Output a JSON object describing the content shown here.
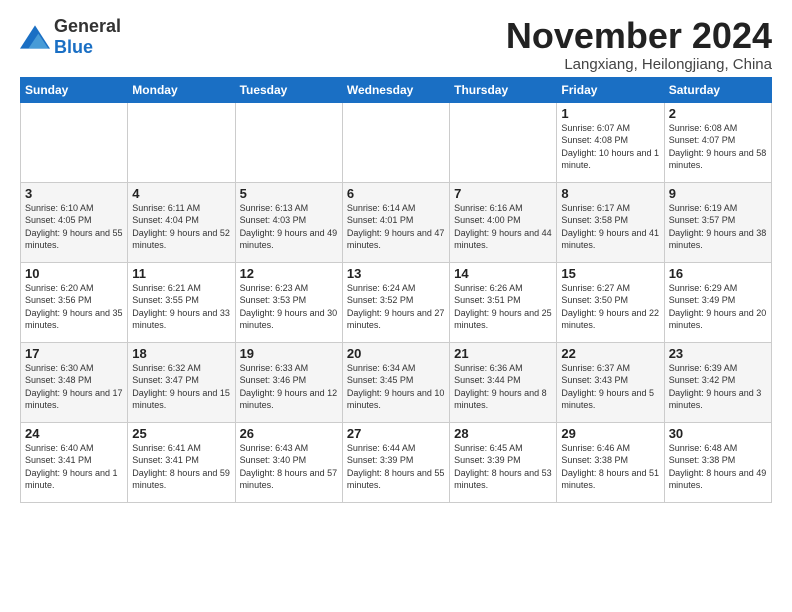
{
  "logo": {
    "general": "General",
    "blue": "Blue"
  },
  "title": "November 2024",
  "subtitle": "Langxiang, Heilongjiang, China",
  "weekdays": [
    "Sunday",
    "Monday",
    "Tuesday",
    "Wednesday",
    "Thursday",
    "Friday",
    "Saturday"
  ],
  "weeks": [
    [
      {
        "day": "",
        "info": ""
      },
      {
        "day": "",
        "info": ""
      },
      {
        "day": "",
        "info": ""
      },
      {
        "day": "",
        "info": ""
      },
      {
        "day": "",
        "info": ""
      },
      {
        "day": "1",
        "info": "Sunrise: 6:07 AM\nSunset: 4:08 PM\nDaylight: 10 hours\nand 1 minute."
      },
      {
        "day": "2",
        "info": "Sunrise: 6:08 AM\nSunset: 4:07 PM\nDaylight: 9 hours\nand 58 minutes."
      }
    ],
    [
      {
        "day": "3",
        "info": "Sunrise: 6:10 AM\nSunset: 4:05 PM\nDaylight: 9 hours\nand 55 minutes."
      },
      {
        "day": "4",
        "info": "Sunrise: 6:11 AM\nSunset: 4:04 PM\nDaylight: 9 hours\nand 52 minutes."
      },
      {
        "day": "5",
        "info": "Sunrise: 6:13 AM\nSunset: 4:03 PM\nDaylight: 9 hours\nand 49 minutes."
      },
      {
        "day": "6",
        "info": "Sunrise: 6:14 AM\nSunset: 4:01 PM\nDaylight: 9 hours\nand 47 minutes."
      },
      {
        "day": "7",
        "info": "Sunrise: 6:16 AM\nSunset: 4:00 PM\nDaylight: 9 hours\nand 44 minutes."
      },
      {
        "day": "8",
        "info": "Sunrise: 6:17 AM\nSunset: 3:58 PM\nDaylight: 9 hours\nand 41 minutes."
      },
      {
        "day": "9",
        "info": "Sunrise: 6:19 AM\nSunset: 3:57 PM\nDaylight: 9 hours\nand 38 minutes."
      }
    ],
    [
      {
        "day": "10",
        "info": "Sunrise: 6:20 AM\nSunset: 3:56 PM\nDaylight: 9 hours\nand 35 minutes."
      },
      {
        "day": "11",
        "info": "Sunrise: 6:21 AM\nSunset: 3:55 PM\nDaylight: 9 hours\nand 33 minutes."
      },
      {
        "day": "12",
        "info": "Sunrise: 6:23 AM\nSunset: 3:53 PM\nDaylight: 9 hours\nand 30 minutes."
      },
      {
        "day": "13",
        "info": "Sunrise: 6:24 AM\nSunset: 3:52 PM\nDaylight: 9 hours\nand 27 minutes."
      },
      {
        "day": "14",
        "info": "Sunrise: 6:26 AM\nSunset: 3:51 PM\nDaylight: 9 hours\nand 25 minutes."
      },
      {
        "day": "15",
        "info": "Sunrise: 6:27 AM\nSunset: 3:50 PM\nDaylight: 9 hours\nand 22 minutes."
      },
      {
        "day": "16",
        "info": "Sunrise: 6:29 AM\nSunset: 3:49 PM\nDaylight: 9 hours\nand 20 minutes."
      }
    ],
    [
      {
        "day": "17",
        "info": "Sunrise: 6:30 AM\nSunset: 3:48 PM\nDaylight: 9 hours\nand 17 minutes."
      },
      {
        "day": "18",
        "info": "Sunrise: 6:32 AM\nSunset: 3:47 PM\nDaylight: 9 hours\nand 15 minutes."
      },
      {
        "day": "19",
        "info": "Sunrise: 6:33 AM\nSunset: 3:46 PM\nDaylight: 9 hours\nand 12 minutes."
      },
      {
        "day": "20",
        "info": "Sunrise: 6:34 AM\nSunset: 3:45 PM\nDaylight: 9 hours\nand 10 minutes."
      },
      {
        "day": "21",
        "info": "Sunrise: 6:36 AM\nSunset: 3:44 PM\nDaylight: 9 hours\nand 8 minutes."
      },
      {
        "day": "22",
        "info": "Sunrise: 6:37 AM\nSunset: 3:43 PM\nDaylight: 9 hours\nand 5 minutes."
      },
      {
        "day": "23",
        "info": "Sunrise: 6:39 AM\nSunset: 3:42 PM\nDaylight: 9 hours\nand 3 minutes."
      }
    ],
    [
      {
        "day": "24",
        "info": "Sunrise: 6:40 AM\nSunset: 3:41 PM\nDaylight: 9 hours\nand 1 minute."
      },
      {
        "day": "25",
        "info": "Sunrise: 6:41 AM\nSunset: 3:41 PM\nDaylight: 8 hours\nand 59 minutes."
      },
      {
        "day": "26",
        "info": "Sunrise: 6:43 AM\nSunset: 3:40 PM\nDaylight: 8 hours\nand 57 minutes."
      },
      {
        "day": "27",
        "info": "Sunrise: 6:44 AM\nSunset: 3:39 PM\nDaylight: 8 hours\nand 55 minutes."
      },
      {
        "day": "28",
        "info": "Sunrise: 6:45 AM\nSunset: 3:39 PM\nDaylight: 8 hours\nand 53 minutes."
      },
      {
        "day": "29",
        "info": "Sunrise: 6:46 AM\nSunset: 3:38 PM\nDaylight: 8 hours\nand 51 minutes."
      },
      {
        "day": "30",
        "info": "Sunrise: 6:48 AM\nSunset: 3:38 PM\nDaylight: 8 hours\nand 49 minutes."
      }
    ]
  ]
}
